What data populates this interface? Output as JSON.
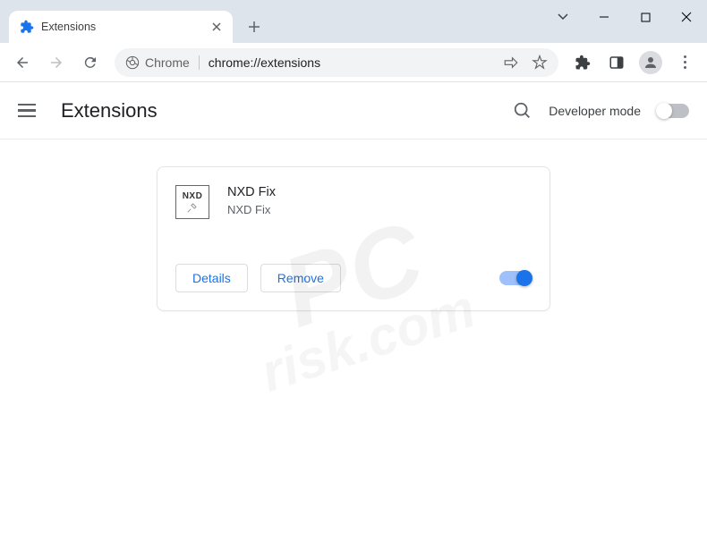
{
  "window": {
    "tab_title": "Extensions",
    "omnibox_prefix": "Chrome",
    "omnibox_url": "chrome://extensions"
  },
  "page": {
    "title": "Extensions",
    "developer_mode_label": "Developer mode",
    "developer_mode_on": false
  },
  "extension": {
    "icon_text": "NXD",
    "name": "NXD Fix",
    "description": "NXD Fix",
    "details_label": "Details",
    "remove_label": "Remove",
    "enabled": true
  },
  "watermark": {
    "main": "PC",
    "sub": "risk.com"
  }
}
